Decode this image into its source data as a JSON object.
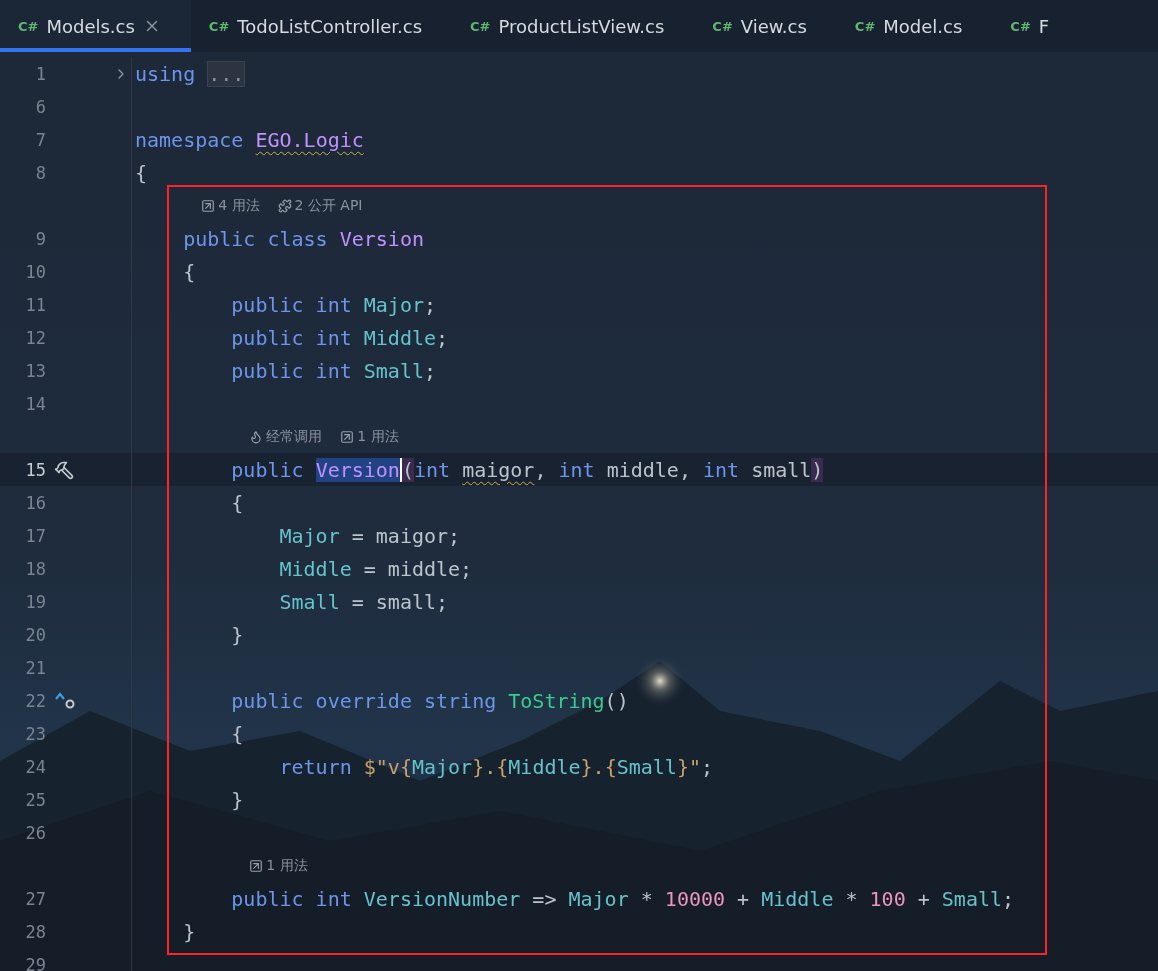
{
  "tabs": [
    {
      "icon_text": "C#",
      "label": "Models.cs",
      "selected": true
    },
    {
      "icon_text": "C#",
      "label": "TodoListController.cs",
      "selected": false
    },
    {
      "icon_text": "C#",
      "label": "ProductListView.cs",
      "selected": false
    },
    {
      "icon_text": "C#",
      "label": "View.cs",
      "selected": false
    },
    {
      "icon_text": "C#",
      "label": "Model.cs",
      "selected": false
    },
    {
      "icon_text": "C#",
      "label": "F",
      "selected": false
    }
  ],
  "editor": {
    "rows": [
      {
        "kind": "code",
        "number": "1",
        "folded": true,
        "tokens": [
          {
            "text": "using ",
            "kind": "kw"
          },
          {
            "text": "...",
            "kind": "fold"
          }
        ]
      },
      {
        "kind": "code",
        "number": "6",
        "tokens": []
      },
      {
        "kind": "code",
        "number": "7",
        "tokens": [
          {
            "text": "namespace ",
            "kind": "kw"
          },
          {
            "text": "EGO.Logic",
            "kind": "ns-warn"
          }
        ]
      },
      {
        "kind": "code",
        "number": "8",
        "tokens": [
          {
            "text": "{",
            "kind": "plain"
          }
        ]
      },
      {
        "kind": "lens",
        "items": [
          {
            "kind": "usages",
            "text": "4 用法"
          },
          {
            "kind": "api",
            "text": "2 公开 API"
          }
        ]
      },
      {
        "kind": "code",
        "number": "9",
        "tokens": [
          {
            "text": "    public class ",
            "kind": "kw"
          },
          {
            "text": "Version",
            "kind": "type"
          }
        ]
      },
      {
        "kind": "code",
        "number": "10",
        "tokens": [
          {
            "text": "    {",
            "kind": "plain"
          }
        ]
      },
      {
        "kind": "code",
        "number": "11",
        "tokens": [
          {
            "text": "        public int ",
            "kind": "kw"
          },
          {
            "text": "Major",
            "kind": "field"
          },
          {
            "text": ";",
            "kind": "plain"
          }
        ]
      },
      {
        "kind": "code",
        "number": "12",
        "tokens": [
          {
            "text": "        public int ",
            "kind": "kw"
          },
          {
            "text": "Middle",
            "kind": "field"
          },
          {
            "text": ";",
            "kind": "plain"
          }
        ]
      },
      {
        "kind": "code",
        "number": "13",
        "tokens": [
          {
            "text": "        public int ",
            "kind": "kw"
          },
          {
            "text": "Small",
            "kind": "field"
          },
          {
            "text": ";",
            "kind": "plain"
          }
        ]
      },
      {
        "kind": "code",
        "number": "14",
        "tokens": []
      },
      {
        "kind": "lens",
        "items": [
          {
            "kind": "hot",
            "text": "经常调用"
          },
          {
            "kind": "usages",
            "text": "1 用法"
          }
        ]
      },
      {
        "kind": "code",
        "number": "15",
        "current": true,
        "gutter": {
          "kind": "hammer"
        },
        "tokens": [
          {
            "text": "        public ",
            "kind": "kw"
          },
          {
            "text": "Version",
            "kind": "sel-type"
          },
          {
            "text": "(",
            "kind": "brace"
          },
          {
            "text": "int ",
            "kind": "kw"
          },
          {
            "text": "maigor",
            "kind": "param-warn"
          },
          {
            "text": ", ",
            "kind": "plain"
          },
          {
            "text": "int",
            "kind": "kw"
          },
          {
            "text": " middle, ",
            "kind": "plain"
          },
          {
            "text": "int",
            "kind": "kw"
          },
          {
            "text": " small",
            "kind": "plain"
          },
          {
            "text": ")",
            "kind": "brace"
          }
        ]
      },
      {
        "kind": "code",
        "number": "16",
        "tokens": [
          {
            "text": "        {",
            "kind": "plain"
          }
        ]
      },
      {
        "kind": "code",
        "number": "17",
        "tokens": [
          {
            "text": "            Major",
            "kind": "field"
          },
          {
            "text": " = maigor;",
            "kind": "plain"
          }
        ]
      },
      {
        "kind": "code",
        "number": "18",
        "tokens": [
          {
            "text": "            Middle",
            "kind": "field"
          },
          {
            "text": " = middle;",
            "kind": "plain"
          }
        ]
      },
      {
        "kind": "code",
        "number": "19",
        "tokens": [
          {
            "text": "            Small",
            "kind": "field"
          },
          {
            "text": " = small;",
            "kind": "plain"
          }
        ]
      },
      {
        "kind": "code",
        "number": "20",
        "tokens": [
          {
            "text": "        }",
            "kind": "plain"
          }
        ]
      },
      {
        "kind": "code",
        "number": "21",
        "tokens": []
      },
      {
        "kind": "code",
        "number": "22",
        "gutter": {
          "kind": "override"
        },
        "tokens": [
          {
            "text": "        public override string ",
            "kind": "kw"
          },
          {
            "text": "ToString",
            "kind": "method"
          },
          {
            "text": "()",
            "kind": "plain"
          }
        ]
      },
      {
        "kind": "code",
        "number": "23",
        "tokens": [
          {
            "text": "        {",
            "kind": "plain"
          }
        ]
      },
      {
        "kind": "code",
        "number": "24",
        "tokens": [
          {
            "text": "            return ",
            "kind": "kw"
          },
          {
            "text": "$\"v{",
            "kind": "str"
          },
          {
            "text": "Major",
            "kind": "field"
          },
          {
            "text": "}.{",
            "kind": "str"
          },
          {
            "text": "Middle",
            "kind": "field"
          },
          {
            "text": "}.{",
            "kind": "str"
          },
          {
            "text": "Small",
            "kind": "field"
          },
          {
            "text": "}\"",
            "kind": "str"
          },
          {
            "text": ";",
            "kind": "plain"
          }
        ]
      },
      {
        "kind": "code",
        "number": "25",
        "tokens": [
          {
            "text": "        }",
            "kind": "plain"
          }
        ]
      },
      {
        "kind": "code",
        "number": "26",
        "tokens": []
      },
      {
        "kind": "lens",
        "items": [
          {
            "kind": "usages",
            "text": "1 用法"
          }
        ]
      },
      {
        "kind": "code",
        "number": "27",
        "tokens": [
          {
            "text": "        public int ",
            "kind": "kw"
          },
          {
            "text": "VersionNumber",
            "kind": "field"
          },
          {
            "text": " => ",
            "kind": "plain"
          },
          {
            "text": "Major",
            "kind": "field"
          },
          {
            "text": " * ",
            "kind": "plain"
          },
          {
            "text": "10000",
            "kind": "num"
          },
          {
            "text": " + ",
            "kind": "plain"
          },
          {
            "text": "Middle",
            "kind": "field"
          },
          {
            "text": " * ",
            "kind": "plain"
          },
          {
            "text": "100",
            "kind": "num"
          },
          {
            "text": " + ",
            "kind": "plain"
          },
          {
            "text": "Small",
            "kind": "field"
          },
          {
            "text": ";",
            "kind": "plain"
          }
        ]
      },
      {
        "kind": "code",
        "number": "28",
        "tokens": [
          {
            "text": "    }",
            "kind": "plain"
          }
        ]
      },
      {
        "kind": "code",
        "number": "29",
        "tokens": []
      }
    ]
  }
}
